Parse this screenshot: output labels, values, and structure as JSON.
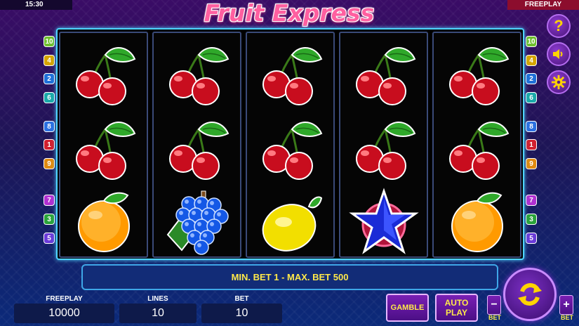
{
  "status": {
    "time": "15:30",
    "mode": "FREEPLAY"
  },
  "title": "Fruit Express",
  "reels": [
    [
      "cherry",
      "cherry",
      "orange"
    ],
    [
      "cherry",
      "cherry",
      "grapes"
    ],
    [
      "cherry",
      "cherry",
      "lemon"
    ],
    [
      "cherry",
      "cherry",
      "star"
    ],
    [
      "cherry",
      "cherry",
      "orange"
    ]
  ],
  "lines_left": [
    {
      "n": "10",
      "color": "#6fbf2f"
    },
    {
      "n": "4",
      "color": "#d6a400"
    },
    {
      "n": "2",
      "color": "#1f6fd8"
    },
    {
      "n": "6",
      "color": "#1aa9a9"
    },
    {
      "n": "8",
      "color": "#2a6fe0"
    },
    {
      "n": "1",
      "color": "#d11f2f"
    },
    {
      "n": "9",
      "color": "#e08a10"
    },
    {
      "n": "7",
      "color": "#b02fd0"
    },
    {
      "n": "3",
      "color": "#2aa33a"
    },
    {
      "n": "5",
      "color": "#6a3ad8"
    }
  ],
  "lines_right": [
    {
      "n": "10",
      "color": "#6fbf2f"
    },
    {
      "n": "4",
      "color": "#d6a400"
    },
    {
      "n": "2",
      "color": "#1f6fd8"
    },
    {
      "n": "6",
      "color": "#1aa9a9"
    },
    {
      "n": "8",
      "color": "#2a6fe0"
    },
    {
      "n": "1",
      "color": "#d11f2f"
    },
    {
      "n": "9",
      "color": "#e08a10"
    },
    {
      "n": "7",
      "color": "#b02fd0"
    },
    {
      "n": "3",
      "color": "#2aa33a"
    },
    {
      "n": "5",
      "color": "#6a3ad8"
    }
  ],
  "side_buttons": {
    "help": "?",
    "sound": "sound-icon",
    "settings": "gear-icon"
  },
  "info": "MIN. BET 1 - MAX. BET 500",
  "bottom": {
    "freeplay_label": "FREEPLAY",
    "freeplay_value": "10000",
    "lines_label": "LINES",
    "lines_value": "10",
    "bet_label": "BET",
    "bet_value": "10",
    "gamble_label": "GAMBLE",
    "auto_label": "AUTO",
    "play_label": "PLAY",
    "bet_minus": "−",
    "bet_plus": "+",
    "bet_text": "BET"
  }
}
